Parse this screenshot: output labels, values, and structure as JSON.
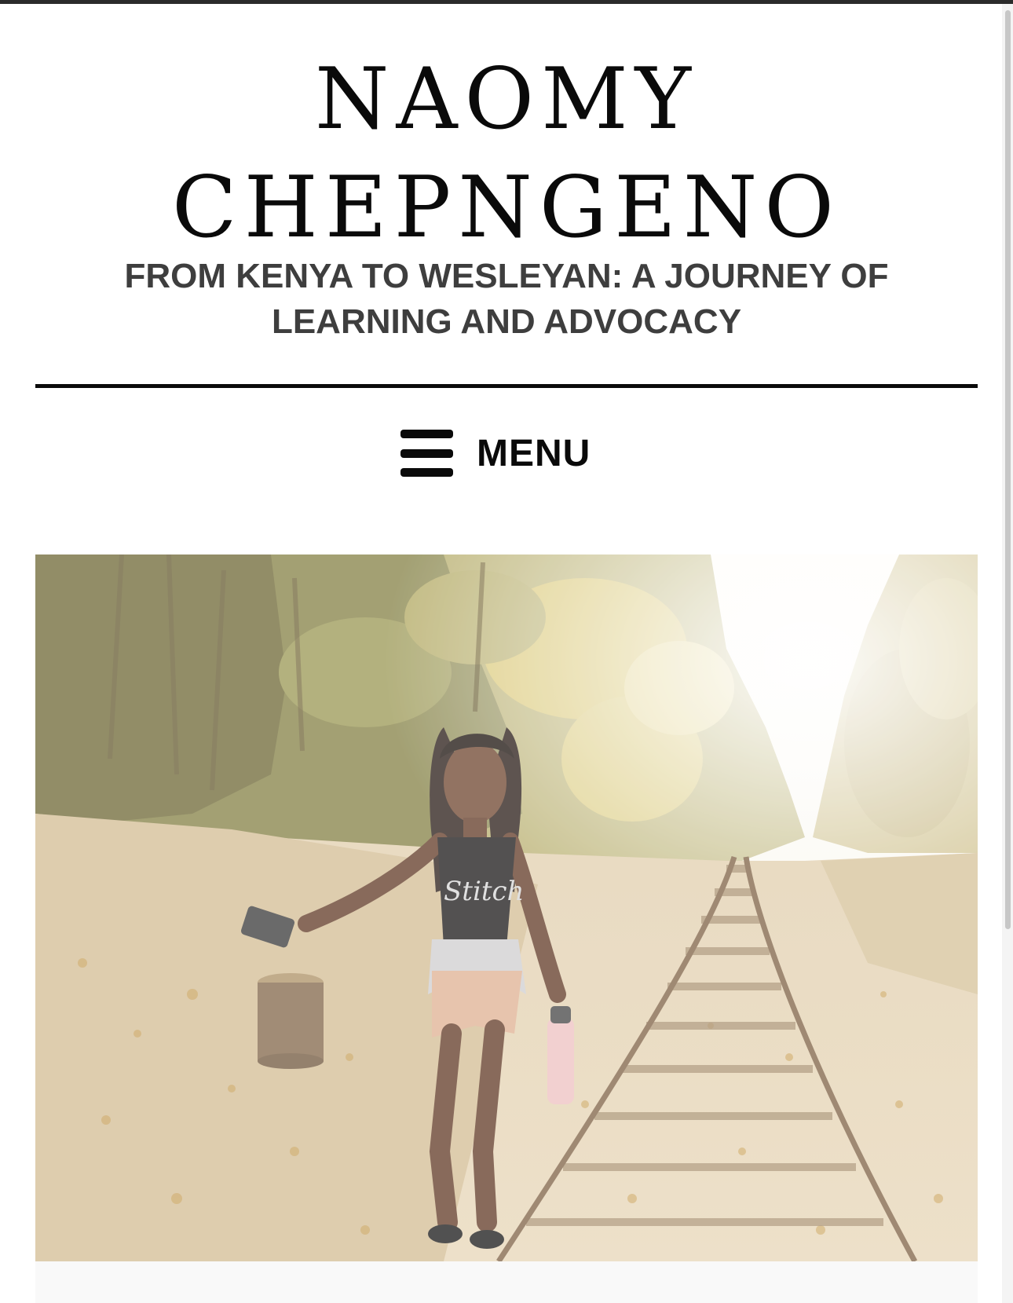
{
  "site": {
    "title_line1": "NAOMY",
    "title_line2": "CHEPNGENO",
    "tagline": "FROM KENYA TO WESLEYAN: A JOURNEY OF LEARNING AND ADVOCACY"
  },
  "nav": {
    "menu_label": "MENU",
    "menu_icon": "hamburger-menu-icon"
  },
  "hero": {
    "shirt_text": "Stitch"
  },
  "colors": {
    "text": "#0a0a0a",
    "tagline": "#3e3e3e",
    "background": "#ffffff"
  }
}
